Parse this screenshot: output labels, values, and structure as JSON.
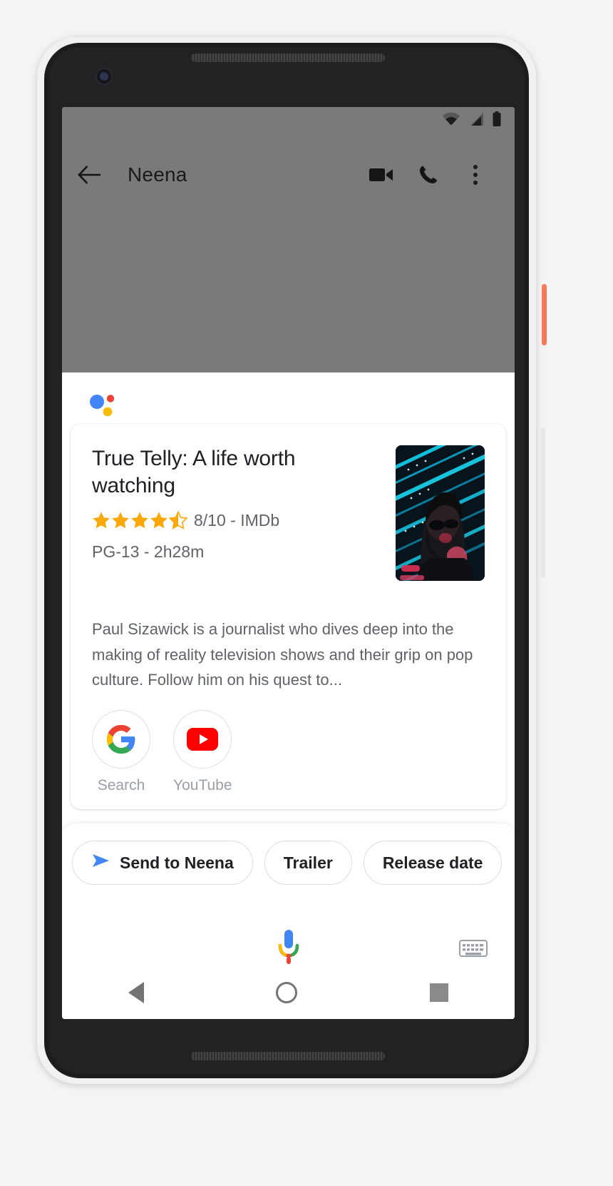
{
  "statusbar": {
    "wifi_icon": "wifi-icon",
    "signal_icon": "cellular-signal-icon",
    "battery_icon": "battery-full-icon"
  },
  "appbar": {
    "back_icon": "back-arrow-icon",
    "title": "Neena",
    "video_call_icon": "video-camera-icon",
    "phone_icon": "phone-icon",
    "overflow_icon": "more-vertical-icon"
  },
  "assistant": {
    "logo_icon": "google-assistant-icon"
  },
  "card": {
    "title": "True Telly: A life worth watching",
    "stars": {
      "filled": 4,
      "half": 1,
      "total": 5,
      "color": "#FBA80A"
    },
    "rating_text": "8/10 - IMDb",
    "meta_text": "PG-13 - 2h28m",
    "description": "Paul Sizawick is a journalist who dives deep into the making of reality television shows and their grip on pop culture. Follow him on his quest to...",
    "poster_alt": "movie-poster-neon-portrait",
    "actions": [
      {
        "label": "Search",
        "icon": "google-g-icon"
      },
      {
        "label": "YouTube",
        "icon": "youtube-icon"
      }
    ]
  },
  "suggestions": {
    "chips": [
      {
        "label": "Send to Neena",
        "icon": "send-icon"
      },
      {
        "label": "Trailer",
        "icon": ""
      },
      {
        "label": "Release date",
        "icon": ""
      }
    ]
  },
  "input_bar": {
    "mic_icon": "microphone-icon",
    "keyboard_icon": "keyboard-icon"
  },
  "navbar": {
    "back_icon": "nav-back-triangle-icon",
    "home_icon": "nav-home-circle-icon",
    "recents_icon": "nav-recents-square-icon"
  },
  "colors": {
    "google_blue": "#4285F4",
    "google_red": "#EA4335",
    "google_yellow": "#FBBC05",
    "google_green": "#34A853",
    "youtube_red": "#FF0000",
    "star_gold": "#FBA80A",
    "text_primary": "#202124",
    "text_secondary": "#5f6368"
  }
}
